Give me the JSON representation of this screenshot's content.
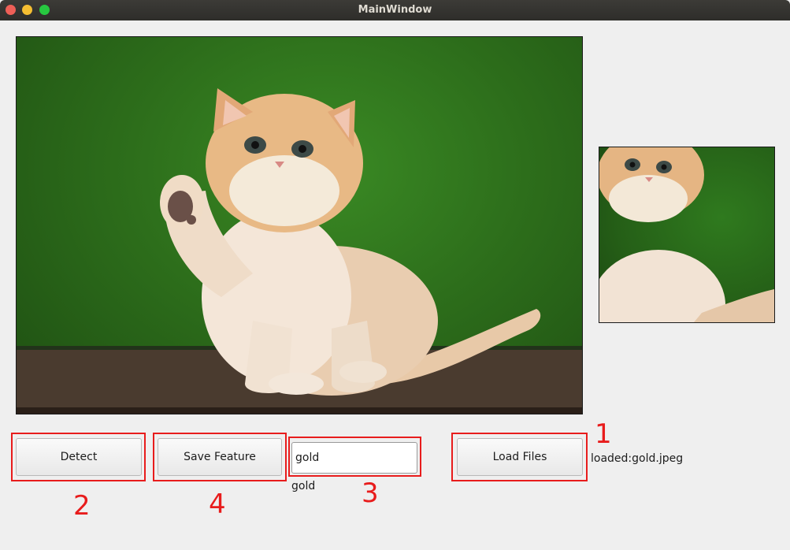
{
  "window": {
    "title": "MainWindow"
  },
  "buttons": {
    "detect": "Detect",
    "save_feature": "Save Feature",
    "load_files": "Load Files"
  },
  "feature_name": {
    "value": "gold",
    "echo": "gold"
  },
  "status": {
    "loaded": "loaded:gold.jpeg"
  },
  "annotations": {
    "load": "1",
    "detect": "2",
    "name_field": "3",
    "save": "4"
  },
  "images": {
    "main": "kitten-photo",
    "crop": "kitten-face-crop"
  },
  "colors": {
    "annotation_red": "#e81c1c",
    "background": "#efefef"
  }
}
